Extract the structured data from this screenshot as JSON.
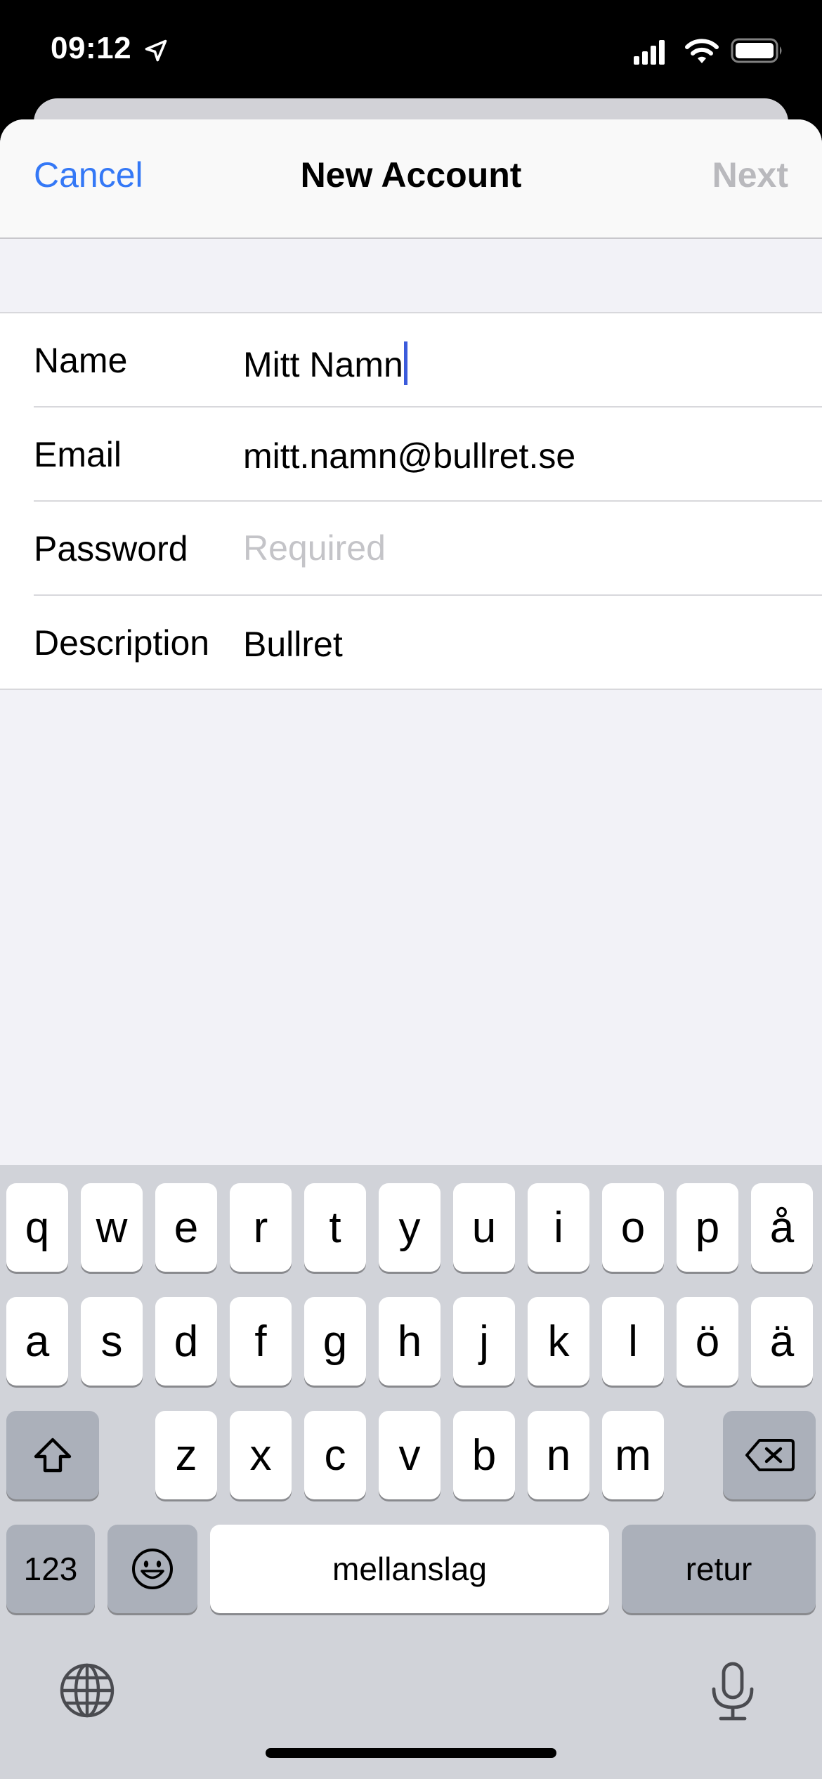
{
  "status_bar": {
    "time": "09:12",
    "icons": [
      "location-arrow-icon",
      "cellular-signal-icon",
      "wifi-icon",
      "battery-icon"
    ]
  },
  "navbar": {
    "cancel_label": "Cancel",
    "title": "New Account",
    "next_label": "Next"
  },
  "form": {
    "name": {
      "label": "Name",
      "value": "Mitt Namn"
    },
    "email": {
      "label": "Email",
      "value": "mitt.namn@bullret.se"
    },
    "password": {
      "label": "Password",
      "placeholder": "Required"
    },
    "description": {
      "label": "Description",
      "value": "Bullret"
    }
  },
  "keyboard": {
    "row1": [
      "q",
      "w",
      "e",
      "r",
      "t",
      "y",
      "u",
      "i",
      "o",
      "p",
      "å"
    ],
    "row2": [
      "a",
      "s",
      "d",
      "f",
      "g",
      "h",
      "j",
      "k",
      "l",
      "ö",
      "ä"
    ],
    "row3": [
      "z",
      "x",
      "c",
      "v",
      "b",
      "n",
      "m"
    ],
    "numbers_label": "123",
    "space_label": "mellanslag",
    "return_label": "retur",
    "icons": [
      "shift-icon",
      "backspace-icon",
      "emoji-icon",
      "globe-icon",
      "microphone-icon"
    ]
  },
  "colors": {
    "accent": "#3478f6",
    "disabled": "#b9b9bd",
    "caret": "#3b5bdb",
    "placeholder": "#c4c4c8"
  }
}
